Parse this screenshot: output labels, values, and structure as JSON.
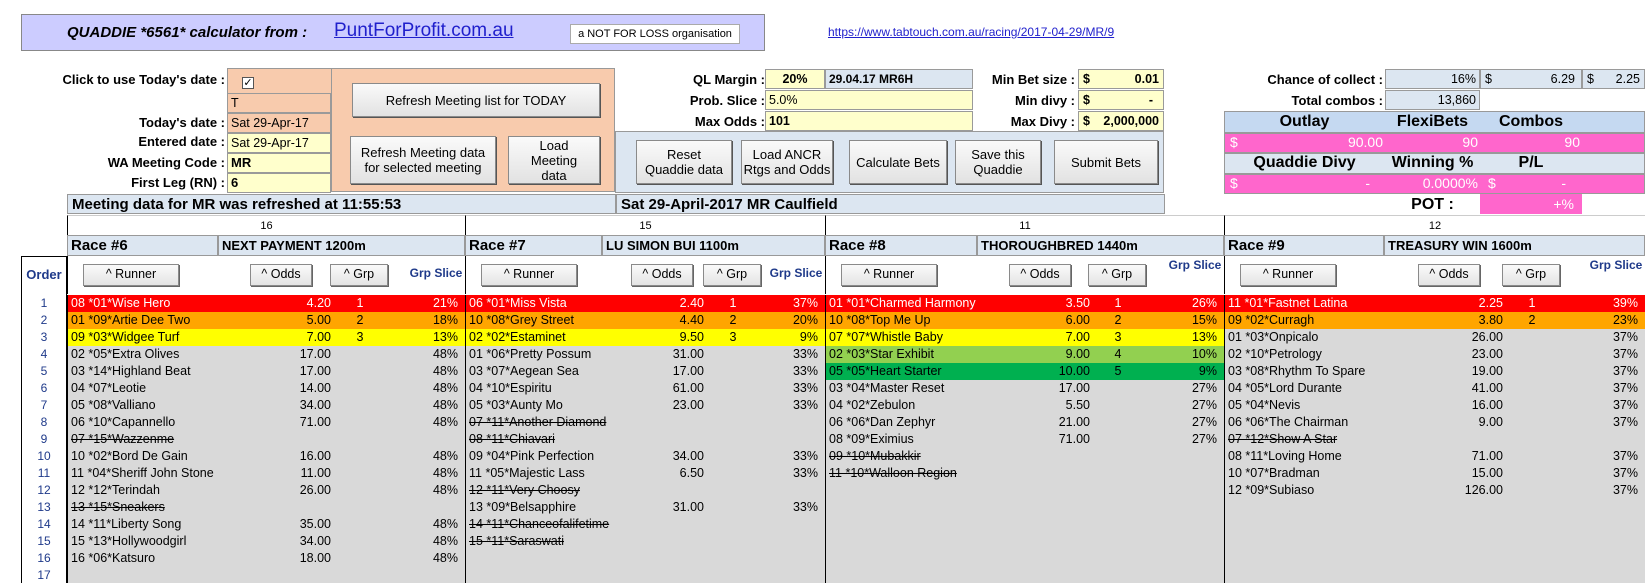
{
  "header": {
    "title": "QUADDIE *6561*  calculator from :",
    "site": "PuntForProfit.com.au",
    "tagline": "a NOT FOR LOSS organisation",
    "url": "https://www.tabtouch.com.au/racing/2017-04-29/MR/9"
  },
  "left_panel": {
    "use_today_label": "Click to use Today's date :",
    "todays_date_label": "Today's date  :",
    "todays_date": "Sat 29-Apr-17",
    "entered_date_label": "Entered date :",
    "entered_date": "Sat 29-Apr-17",
    "meeting_code_label": "WA Meeting Code :",
    "meeting_code": "MR",
    "first_leg_label": "First Leg (RN) :",
    "first_leg": "6",
    "t_value": "T",
    "refresh_today": "Refresh Meeting list for TODAY",
    "refresh_selected": "Refresh Meeting data for selected meeting",
    "load_meeting": "Load Meeting data"
  },
  "settings": {
    "ql_margin_label": "QL Margin :",
    "ql_margin": "20%",
    "meeting_id": "29.04.17 MR6H",
    "prob_slice_label": "Prob. Slice :",
    "prob_slice": "5.0%",
    "max_odds_label": "Max Odds :",
    "max_odds": "101",
    "min_bet_label": "Min Bet size :",
    "min_bet_sym": "$",
    "min_bet": "0.01",
    "min_divy_label": "Min divy :",
    "min_divy_sym": "$",
    "min_divy": "-",
    "max_divy_label": "Max Divy :",
    "max_divy_sym": "$",
    "max_divy": "2,000,000"
  },
  "buttons": {
    "reset": "Reset Quaddie data",
    "load_ancr": "Load ANCR Rtgs and Odds",
    "calculate": "Calculate Bets",
    "save": "Save this Quaddie",
    "submit": "Submit Bets"
  },
  "summary": {
    "chance_label": "Chance of collect :",
    "chance_pct": "16%",
    "chance_sym1": "$",
    "chance_val1": "6.29",
    "chance_sym2": "$",
    "chance_val2": "2.25",
    "total_combos_label": "Total combos :",
    "total_combos": "13,860",
    "outlay_label": "Outlay",
    "flexibets_label": "FlexiBets",
    "combos_label": "Combos",
    "outlay_sym": "$",
    "outlay": "90.00",
    "flexibets": "90",
    "combos": "90",
    "quaddie_divy_label": "Quaddie Divy",
    "winning_pct_label": "Winning %",
    "pl_label": "P/L",
    "divy_sym": "$",
    "divy": "-",
    "winning_pct": "0.0000%",
    "pl_sym": "$",
    "pl": "-",
    "pot_label": "POT :",
    "pot": "+%"
  },
  "status": {
    "refreshed_msg": "Meeting data for MR was refreshed at 11:55:53",
    "meeting_title": "Sat 29-April-2017  MR Caulfield"
  },
  "order_label": "Order",
  "order_numbers": [
    "1",
    "2",
    "3",
    "4",
    "5",
    "6",
    "7",
    "8",
    "9",
    "10",
    "11",
    "12",
    "13",
    "14",
    "15",
    "16",
    "17"
  ],
  "col_headers": {
    "runner": "^ Runner",
    "odds": "^ Odds",
    "grp": "^ Grp",
    "grp_slice": "Grp Slice"
  },
  "races": [
    {
      "count": "16",
      "race_no": "Race #6",
      "race_name": "NEXT PAYMENT 1200m",
      "runners": [
        {
          "name": "08 *01*Wise Hero",
          "odds": "4.20",
          "grp": "1",
          "slice": "21%",
          "color": "#ff0000",
          "fg": "#ffffff",
          "scr": false
        },
        {
          "name": "01 *09*Artie Dee Two",
          "odds": "5.00",
          "grp": "2",
          "slice": "18%",
          "color": "#ffa500",
          "fg": "#000000",
          "scr": false
        },
        {
          "name": "09 *03*Widgee Turf",
          "odds": "7.00",
          "grp": "3",
          "slice": "13%",
          "color": "#ffff00",
          "fg": "#000000",
          "scr": false
        },
        {
          "name": "02 *05*Extra Olives",
          "odds": "17.00",
          "grp": "",
          "slice": "48%",
          "scr": false
        },
        {
          "name": "03 *14*Highland Beat",
          "odds": "17.00",
          "grp": "",
          "slice": "48%",
          "scr": false
        },
        {
          "name": "04 *07*Leotie",
          "odds": "14.00",
          "grp": "",
          "slice": "48%",
          "scr": false
        },
        {
          "name": "05 *08*Valliano",
          "odds": "34.00",
          "grp": "",
          "slice": "48%",
          "scr": false
        },
        {
          "name": "06 *10*Capannello",
          "odds": "71.00",
          "grp": "",
          "slice": "48%",
          "scr": false
        },
        {
          "name": "07 *15*Wazzenme",
          "odds": "",
          "grp": "",
          "slice": "",
          "scr": true
        },
        {
          "name": "10 *02*Bord De Gain",
          "odds": "16.00",
          "grp": "",
          "slice": "48%",
          "scr": false
        },
        {
          "name": "11 *04*Sheriff John Stone",
          "odds": "11.00",
          "grp": "",
          "slice": "48%",
          "scr": false
        },
        {
          "name": "12 *12*Terindah",
          "odds": "26.00",
          "grp": "",
          "slice": "48%",
          "scr": false
        },
        {
          "name": "13 *15*Sneakers",
          "odds": "",
          "grp": "",
          "slice": "",
          "scr": true
        },
        {
          "name": "14 *11*Liberty Song",
          "odds": "35.00",
          "grp": "",
          "slice": "48%",
          "scr": false
        },
        {
          "name": "15 *13*Hollywoodgirl",
          "odds": "34.00",
          "grp": "",
          "slice": "48%",
          "scr": false
        },
        {
          "name": "16 *06*Katsuro",
          "odds": "18.00",
          "grp": "",
          "slice": "48%",
          "scr": false
        }
      ]
    },
    {
      "count": "15",
      "race_no": "Race #7",
      "race_name": "LU SIMON BUI 1100m",
      "runners": [
        {
          "name": "06 *01*Miss Vista",
          "odds": "2.40",
          "grp": "1",
          "slice": "37%",
          "color": "#ff0000",
          "fg": "#ffffff",
          "scr": false
        },
        {
          "name": "10 *08*Grey Street",
          "odds": "4.40",
          "grp": "2",
          "slice": "20%",
          "color": "#ffa500",
          "fg": "#000000",
          "scr": false
        },
        {
          "name": "02 *02*Estaminet",
          "odds": "9.50",
          "grp": "3",
          "slice": "9%",
          "color": "#ffff00",
          "fg": "#000000",
          "scr": false
        },
        {
          "name": "01 *06*Pretty Possum",
          "odds": "31.00",
          "grp": "",
          "slice": "33%",
          "scr": false
        },
        {
          "name": "03 *07*Aegean Sea",
          "odds": "17.00",
          "grp": "",
          "slice": "33%",
          "scr": false
        },
        {
          "name": "04 *10*Espiritu",
          "odds": "61.00",
          "grp": "",
          "slice": "33%",
          "scr": false
        },
        {
          "name": "05 *03*Aunty Mo",
          "odds": "23.00",
          "grp": "",
          "slice": "33%",
          "scr": false
        },
        {
          "name": "07 *11*Another Diamond",
          "odds": "",
          "grp": "",
          "slice": "",
          "scr": true
        },
        {
          "name": "08 *11*Chiavari",
          "odds": "",
          "grp": "",
          "slice": "",
          "scr": true
        },
        {
          "name": "09 *04*Pink Perfection",
          "odds": "34.00",
          "grp": "",
          "slice": "33%",
          "scr": false
        },
        {
          "name": "11 *05*Majestic Lass",
          "odds": "6.50",
          "grp": "",
          "slice": "33%",
          "scr": false
        },
        {
          "name": "12 *11*Very Choosy",
          "odds": "",
          "grp": "",
          "slice": "",
          "scr": true
        },
        {
          "name": "13 *09*Belsapphire",
          "odds": "31.00",
          "grp": "",
          "slice": "33%",
          "scr": false
        },
        {
          "name": "14 *11*Chanceofalifetime",
          "odds": "",
          "grp": "",
          "slice": "",
          "scr": true
        },
        {
          "name": "15 *11*Saraswati",
          "odds": "",
          "grp": "",
          "slice": "",
          "scr": true
        }
      ]
    },
    {
      "count": "11",
      "race_no": "Race #8",
      "race_name": "THOROUGHBRED 1440m",
      "runners": [
        {
          "name": "01 *01*Charmed Harmony",
          "odds": "3.50",
          "grp": "1",
          "slice": "26%",
          "color": "#ff0000",
          "fg": "#ffffff",
          "scr": false
        },
        {
          "name": "10 *08*Top Me Up",
          "odds": "6.00",
          "grp": "2",
          "slice": "15%",
          "color": "#ffa500",
          "fg": "#000000",
          "scr": false
        },
        {
          "name": "07 *07*Whistle Baby",
          "odds": "7.00",
          "grp": "3",
          "slice": "13%",
          "color": "#ffff00",
          "fg": "#000000",
          "scr": false
        },
        {
          "name": "02 *03*Star Exhibit",
          "odds": "9.00",
          "grp": "4",
          "slice": "10%",
          "color": "#92d050",
          "fg": "#000000",
          "scr": false
        },
        {
          "name": "05 *05*Heart Starter",
          "odds": "10.00",
          "grp": "5",
          "slice": "9%",
          "color": "#00b050",
          "fg": "#000000",
          "scr": false
        },
        {
          "name": "03 *04*Master Reset",
          "odds": "17.00",
          "grp": "",
          "slice": "27%",
          "scr": false
        },
        {
          "name": "04 *02*Zebulon",
          "odds": "5.50",
          "grp": "",
          "slice": "27%",
          "scr": false
        },
        {
          "name": "06 *06*Dan Zephyr",
          "odds": "21.00",
          "grp": "",
          "slice": "27%",
          "scr": false
        },
        {
          "name": "08 *09*Eximius",
          "odds": "71.00",
          "grp": "",
          "slice": "27%",
          "scr": false
        },
        {
          "name": "09 *10*Mubakkir",
          "odds": "",
          "grp": "",
          "slice": "",
          "scr": true
        },
        {
          "name": "11 *10*Walloon Region",
          "odds": "",
          "grp": "",
          "slice": "",
          "scr": true
        }
      ]
    },
    {
      "count": "12",
      "race_no": "Race #9",
      "race_name": "TREASURY WIN 1600m",
      "runners": [
        {
          "name": "11 *01*Fastnet Latina",
          "odds": "2.25",
          "grp": "1",
          "slice": "39%",
          "color": "#ff0000",
          "fg": "#ffffff",
          "scr": false
        },
        {
          "name": "09 *02*Curragh",
          "odds": "3.80",
          "grp": "2",
          "slice": "23%",
          "color": "#ffa500",
          "fg": "#000000",
          "scr": false
        },
        {
          "name": "01 *03*Onpicalo",
          "odds": "26.00",
          "grp": "",
          "slice": "37%",
          "scr": false
        },
        {
          "name": "02 *10*Petrology",
          "odds": "23.00",
          "grp": "",
          "slice": "37%",
          "scr": false
        },
        {
          "name": "03 *08*Rhythm To Spare",
          "odds": "19.00",
          "grp": "",
          "slice": "37%",
          "scr": false
        },
        {
          "name": "04 *05*Lord Durante",
          "odds": "41.00",
          "grp": "",
          "slice": "37%",
          "scr": false
        },
        {
          "name": "05 *04*Nevis",
          "odds": "16.00",
          "grp": "",
          "slice": "37%",
          "scr": false
        },
        {
          "name": "06 *06*The Chairman",
          "odds": "9.00",
          "grp": "",
          "slice": "37%",
          "scr": false
        },
        {
          "name": "07 *12*Show A Star",
          "odds": "",
          "grp": "",
          "slice": "",
          "scr": true
        },
        {
          "name": "08 *11*Loving Home",
          "odds": "71.00",
          "grp": "",
          "slice": "37%",
          "scr": false
        },
        {
          "name": "10 *07*Bradman",
          "odds": "15.00",
          "grp": "",
          "slice": "37%",
          "scr": false
        },
        {
          "name": "12 *09*Subiaso",
          "odds": "126.00",
          "grp": "",
          "slice": "37%",
          "scr": false
        }
      ]
    }
  ],
  "colors": {
    "header_bg": "#ccccff",
    "peach": "#f8cbad",
    "cream": "#ffffcc",
    "light_blue": "#dce6f1",
    "pink": "#ff66cc",
    "grey_rows": "#d9d9d9"
  }
}
